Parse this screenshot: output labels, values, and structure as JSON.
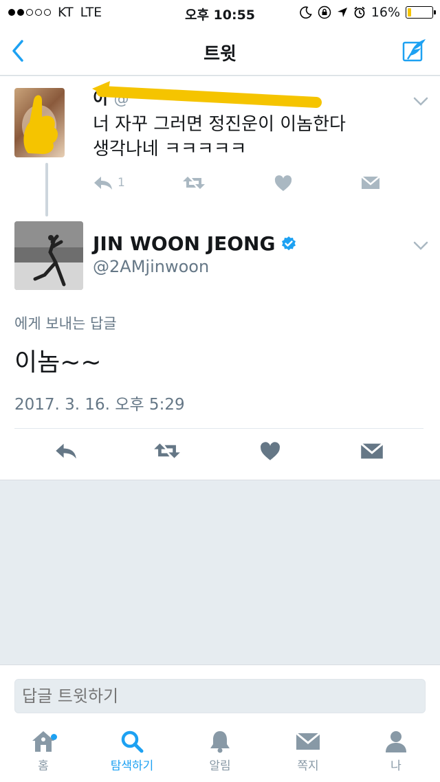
{
  "status_bar": {
    "carrier": "KT",
    "network": "LTE",
    "time": "오후 10:55",
    "battery": "16%",
    "battery_level": 0.16
  },
  "nav": {
    "title": "트윗"
  },
  "parent_tweet": {
    "name": "이",
    "handle": "@",
    "text_line1": "너 자꾸 그러면 정진운이 이놈한다",
    "text_line2": "생각나네 ㅋㅋㅋㅋㅋ",
    "reply_count": "1"
  },
  "main_tweet": {
    "author_name": "JIN WOON JEONG",
    "author_handle": "@2AMjinwoon",
    "reply_label": "에게 보내는 답글",
    "text": "이놈~~",
    "timestamp": "2017. 3. 16. 오후 5:29"
  },
  "reply_box": {
    "placeholder": "답글 트윗하기"
  },
  "tabs": [
    {
      "label": "홈",
      "icon": "home-icon"
    },
    {
      "label": "탐색하기",
      "icon": "search-icon"
    },
    {
      "label": "알림",
      "icon": "bell-icon"
    },
    {
      "label": "쪽지",
      "icon": "mail-icon"
    },
    {
      "label": "나",
      "icon": "person-icon"
    }
  ],
  "colors": {
    "accent": "#1da1f2",
    "highlight": "#f5c400",
    "verified": "#1da1f2"
  }
}
